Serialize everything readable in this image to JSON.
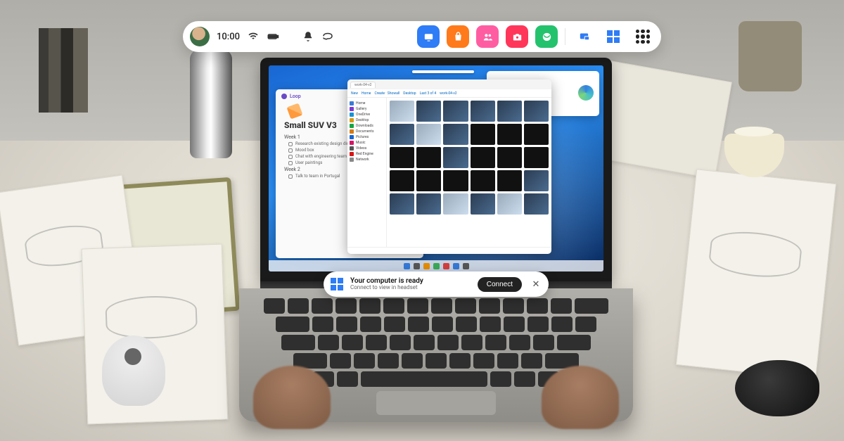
{
  "vr_bar": {
    "time": "10:00",
    "apps": [
      "tv",
      "store",
      "people",
      "camera",
      "browser",
      "cast",
      "windows",
      "all-apps"
    ]
  },
  "notification": {
    "title": "Your computer is ready",
    "subtitle": "Connect to view in headset",
    "button": "Connect"
  },
  "laptop": {
    "loop": {
      "app": "Loop",
      "title": "Small SUV V3",
      "section1": "Week 1",
      "bullets1": [
        "Research existing design direction",
        "Mood box",
        "Chat with engineering team",
        "User paintings"
      ],
      "section2": "Week 2",
      "bullets2": [
        "Talk to team in Portugal"
      ]
    },
    "explorer": {
      "tab": "work-04-v2",
      "toolbar": [
        "New",
        "Home",
        "Create · Showall",
        "Desktop",
        "Last 3 of 4",
        "work-04-v2"
      ],
      "sidebar": [
        "Home",
        "Gallery",
        "OneDrive",
        "Desktop",
        "Downloads",
        "Documents",
        "Pictures",
        "Music",
        "Videos",
        "Red Engine",
        "Network"
      ]
    }
  }
}
